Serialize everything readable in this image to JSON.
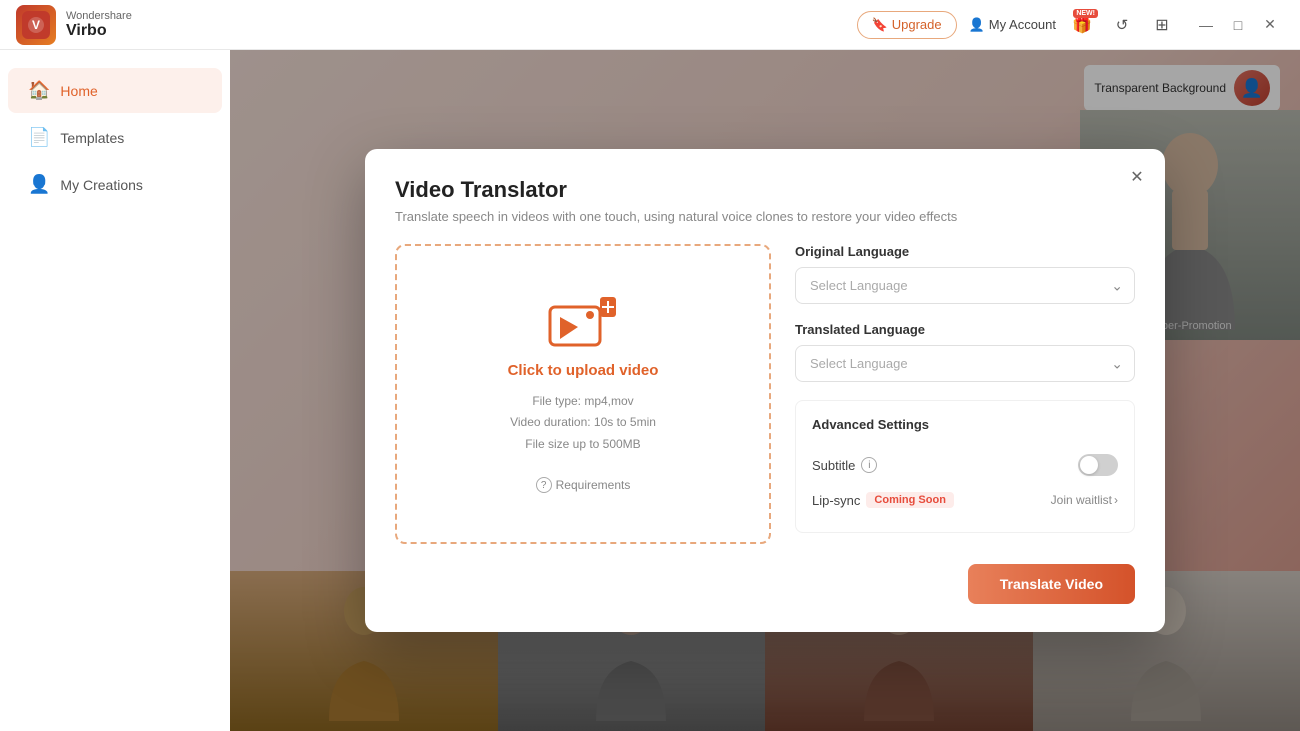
{
  "app": {
    "brand": "Wondershare",
    "name": "Virbo",
    "logo_char": "V"
  },
  "titlebar": {
    "upgrade_label": "Upgrade",
    "my_account_label": "My Account",
    "icons": {
      "gift_icon": "🎁",
      "clock_icon": "⟲",
      "grid_icon": "⊞",
      "new_badge": "NEW!"
    },
    "window_controls": {
      "minimize": "—",
      "maximize": "□",
      "close": "✕"
    }
  },
  "sidebar": {
    "items": [
      {
        "id": "home",
        "label": "Home",
        "icon": "🏠",
        "active": true
      },
      {
        "id": "templates",
        "label": "Templates",
        "icon": "📄",
        "active": false
      },
      {
        "id": "my-creations",
        "label": "My Creations",
        "icon": "👤",
        "active": false
      }
    ]
  },
  "content": {
    "transparent_bg_label": "Transparent Background",
    "avatar_label": "Super-Promotion"
  },
  "modal": {
    "title": "Video Translator",
    "subtitle": "Translate speech in videos with one touch, using natural voice clones to restore your video effects",
    "close_icon": "✕",
    "upload": {
      "click_label": "Click to upload video",
      "file_type_info": "File type: mp4,mov",
      "duration_info": "Video duration: 10s to 5min",
      "size_info": "File size up to  500MB",
      "requirements_label": "Requirements",
      "requirements_icon": "?"
    },
    "settings": {
      "original_language_label": "Original Language",
      "original_language_placeholder": "Select Language",
      "translated_language_label": "Translated Language",
      "translated_language_placeholder": "Select Language",
      "advanced_settings_label": "Advanced Settings",
      "subtitle_label": "Subtitle",
      "subtitle_toggle": false,
      "lipsync_label": "Lip-sync",
      "coming_soon_label": "Coming Soon",
      "join_waitlist_label": "Join waitlist"
    },
    "footer": {
      "translate_btn_label": "Translate Video"
    }
  },
  "colors": {
    "primary": "#e0622a",
    "primary_light": "#fdf0eb",
    "danger": "#e74c3c",
    "border": "#e0e0e0",
    "text_muted": "#888888"
  }
}
